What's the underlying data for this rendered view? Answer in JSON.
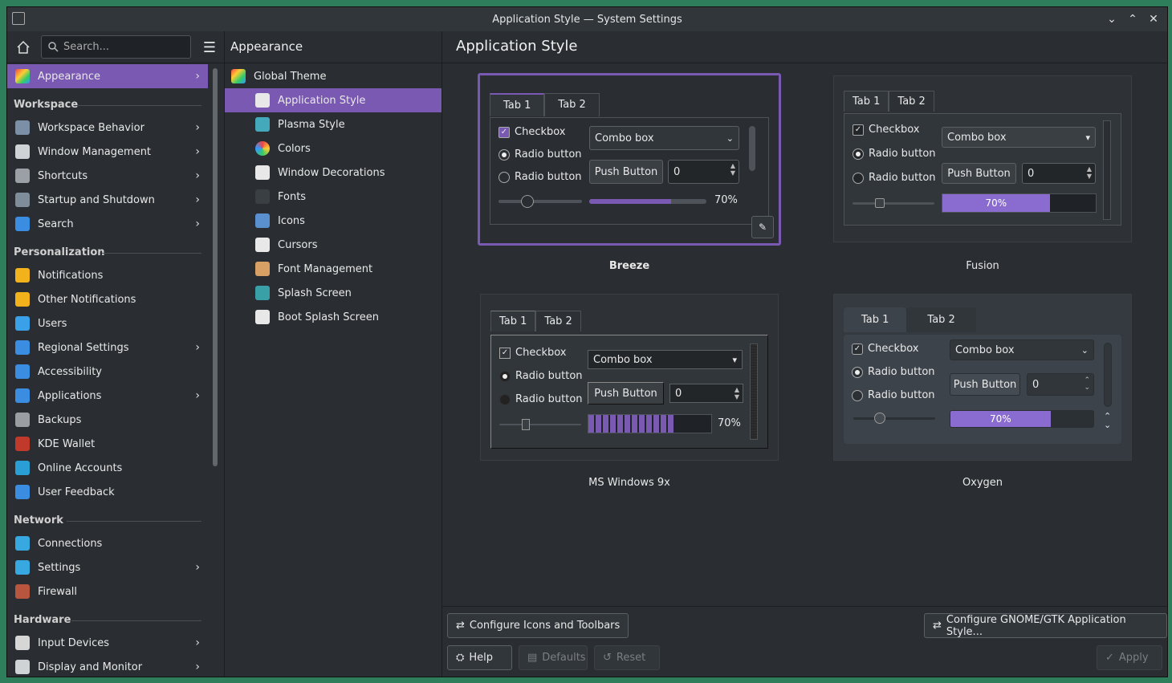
{
  "window": {
    "title": "Application Style — System Settings"
  },
  "search": {
    "placeholder": "Search..."
  },
  "header": {
    "middle": "Appearance",
    "right": "Application Style"
  },
  "sidebar": {
    "top": {
      "label": "Appearance"
    },
    "sections": [
      {
        "title": "Workspace",
        "items": [
          {
            "label": "Workspace Behavior",
            "chev": true
          },
          {
            "label": "Window Management",
            "chev": true
          },
          {
            "label": "Shortcuts",
            "chev": true
          },
          {
            "label": "Startup and Shutdown",
            "chev": true
          },
          {
            "label": "Search",
            "chev": true
          }
        ]
      },
      {
        "title": "Personalization",
        "items": [
          {
            "label": "Notifications"
          },
          {
            "label": "Other Notifications"
          },
          {
            "label": "Users"
          },
          {
            "label": "Regional Settings",
            "chev": true
          },
          {
            "label": "Accessibility"
          },
          {
            "label": "Applications",
            "chev": true
          },
          {
            "label": "Backups"
          },
          {
            "label": "KDE Wallet"
          },
          {
            "label": "Online Accounts"
          },
          {
            "label": "User Feedback"
          }
        ]
      },
      {
        "title": "Network",
        "items": [
          {
            "label": "Connections"
          },
          {
            "label": "Settings",
            "chev": true
          },
          {
            "label": "Firewall"
          }
        ]
      },
      {
        "title": "Hardware",
        "items": [
          {
            "label": "Input Devices",
            "chev": true
          },
          {
            "label": "Display and Monitor",
            "chev": true
          }
        ]
      }
    ]
  },
  "middle": {
    "items": [
      {
        "label": "Global Theme"
      },
      {
        "label": "Application Style"
      },
      {
        "label": "Plasma Style"
      },
      {
        "label": "Colors"
      },
      {
        "label": "Window Decorations"
      },
      {
        "label": "Fonts"
      },
      {
        "label": "Icons"
      },
      {
        "label": "Cursors"
      },
      {
        "label": "Font Management"
      },
      {
        "label": "Splash Screen"
      },
      {
        "label": "Boot Splash Screen"
      }
    ]
  },
  "preview": {
    "tab1": "Tab 1",
    "tab2": "Tab 2",
    "checkbox": "Checkbox",
    "radio": "Radio button",
    "combo": "Combo box",
    "push": "Push Button",
    "spin": "0",
    "progress": "70%",
    "progress_value": 0.7
  },
  "styles": {
    "breeze": "Breeze",
    "fusion": "Fusion",
    "win9x": "MS Windows 9x",
    "oxygen": "Oxygen"
  },
  "bottom": {
    "configure_icons": "Configure Icons and Toolbars",
    "configure_gtk": "Configure GNOME/GTK Application Style...",
    "help": "Help",
    "defaults": "Defaults",
    "reset": "Reset",
    "apply": "Apply"
  },
  "colors": {
    "accent": "#7a59b2"
  }
}
